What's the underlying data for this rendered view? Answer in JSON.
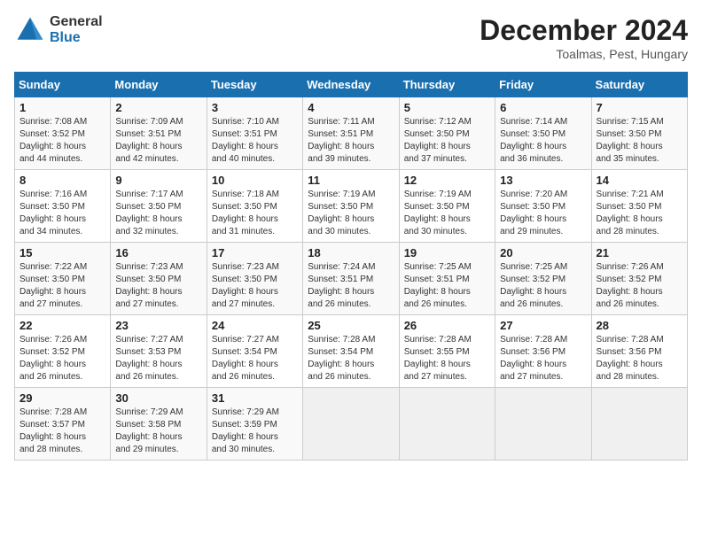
{
  "logo": {
    "general": "General",
    "blue": "Blue"
  },
  "title": {
    "month": "December 2024",
    "location": "Toalmas, Pest, Hungary"
  },
  "weekdays": [
    "Sunday",
    "Monday",
    "Tuesday",
    "Wednesday",
    "Thursday",
    "Friday",
    "Saturday"
  ],
  "weeks": [
    [
      {
        "day": 1,
        "info": "Sunrise: 7:08 AM\nSunset: 3:52 PM\nDaylight: 8 hours\nand 44 minutes."
      },
      {
        "day": 2,
        "info": "Sunrise: 7:09 AM\nSunset: 3:51 PM\nDaylight: 8 hours\nand 42 minutes."
      },
      {
        "day": 3,
        "info": "Sunrise: 7:10 AM\nSunset: 3:51 PM\nDaylight: 8 hours\nand 40 minutes."
      },
      {
        "day": 4,
        "info": "Sunrise: 7:11 AM\nSunset: 3:51 PM\nDaylight: 8 hours\nand 39 minutes."
      },
      {
        "day": 5,
        "info": "Sunrise: 7:12 AM\nSunset: 3:50 PM\nDaylight: 8 hours\nand 37 minutes."
      },
      {
        "day": 6,
        "info": "Sunrise: 7:14 AM\nSunset: 3:50 PM\nDaylight: 8 hours\nand 36 minutes."
      },
      {
        "day": 7,
        "info": "Sunrise: 7:15 AM\nSunset: 3:50 PM\nDaylight: 8 hours\nand 35 minutes."
      }
    ],
    [
      {
        "day": 8,
        "info": "Sunrise: 7:16 AM\nSunset: 3:50 PM\nDaylight: 8 hours\nand 34 minutes."
      },
      {
        "day": 9,
        "info": "Sunrise: 7:17 AM\nSunset: 3:50 PM\nDaylight: 8 hours\nand 32 minutes."
      },
      {
        "day": 10,
        "info": "Sunrise: 7:18 AM\nSunset: 3:50 PM\nDaylight: 8 hours\nand 31 minutes."
      },
      {
        "day": 11,
        "info": "Sunrise: 7:19 AM\nSunset: 3:50 PM\nDaylight: 8 hours\nand 30 minutes."
      },
      {
        "day": 12,
        "info": "Sunrise: 7:19 AM\nSunset: 3:50 PM\nDaylight: 8 hours\nand 30 minutes."
      },
      {
        "day": 13,
        "info": "Sunrise: 7:20 AM\nSunset: 3:50 PM\nDaylight: 8 hours\nand 29 minutes."
      },
      {
        "day": 14,
        "info": "Sunrise: 7:21 AM\nSunset: 3:50 PM\nDaylight: 8 hours\nand 28 minutes."
      }
    ],
    [
      {
        "day": 15,
        "info": "Sunrise: 7:22 AM\nSunset: 3:50 PM\nDaylight: 8 hours\nand 27 minutes."
      },
      {
        "day": 16,
        "info": "Sunrise: 7:23 AM\nSunset: 3:50 PM\nDaylight: 8 hours\nand 27 minutes."
      },
      {
        "day": 17,
        "info": "Sunrise: 7:23 AM\nSunset: 3:50 PM\nDaylight: 8 hours\nand 27 minutes."
      },
      {
        "day": 18,
        "info": "Sunrise: 7:24 AM\nSunset: 3:51 PM\nDaylight: 8 hours\nand 26 minutes."
      },
      {
        "day": 19,
        "info": "Sunrise: 7:25 AM\nSunset: 3:51 PM\nDaylight: 8 hours\nand 26 minutes."
      },
      {
        "day": 20,
        "info": "Sunrise: 7:25 AM\nSunset: 3:52 PM\nDaylight: 8 hours\nand 26 minutes."
      },
      {
        "day": 21,
        "info": "Sunrise: 7:26 AM\nSunset: 3:52 PM\nDaylight: 8 hours\nand 26 minutes."
      }
    ],
    [
      {
        "day": 22,
        "info": "Sunrise: 7:26 AM\nSunset: 3:52 PM\nDaylight: 8 hours\nand 26 minutes."
      },
      {
        "day": 23,
        "info": "Sunrise: 7:27 AM\nSunset: 3:53 PM\nDaylight: 8 hours\nand 26 minutes."
      },
      {
        "day": 24,
        "info": "Sunrise: 7:27 AM\nSunset: 3:54 PM\nDaylight: 8 hours\nand 26 minutes."
      },
      {
        "day": 25,
        "info": "Sunrise: 7:28 AM\nSunset: 3:54 PM\nDaylight: 8 hours\nand 26 minutes."
      },
      {
        "day": 26,
        "info": "Sunrise: 7:28 AM\nSunset: 3:55 PM\nDaylight: 8 hours\nand 27 minutes."
      },
      {
        "day": 27,
        "info": "Sunrise: 7:28 AM\nSunset: 3:56 PM\nDaylight: 8 hours\nand 27 minutes."
      },
      {
        "day": 28,
        "info": "Sunrise: 7:28 AM\nSunset: 3:56 PM\nDaylight: 8 hours\nand 28 minutes."
      }
    ],
    [
      {
        "day": 29,
        "info": "Sunrise: 7:28 AM\nSunset: 3:57 PM\nDaylight: 8 hours\nand 28 minutes."
      },
      {
        "day": 30,
        "info": "Sunrise: 7:29 AM\nSunset: 3:58 PM\nDaylight: 8 hours\nand 29 minutes."
      },
      {
        "day": 31,
        "info": "Sunrise: 7:29 AM\nSunset: 3:59 PM\nDaylight: 8 hours\nand 30 minutes."
      },
      null,
      null,
      null,
      null
    ]
  ]
}
